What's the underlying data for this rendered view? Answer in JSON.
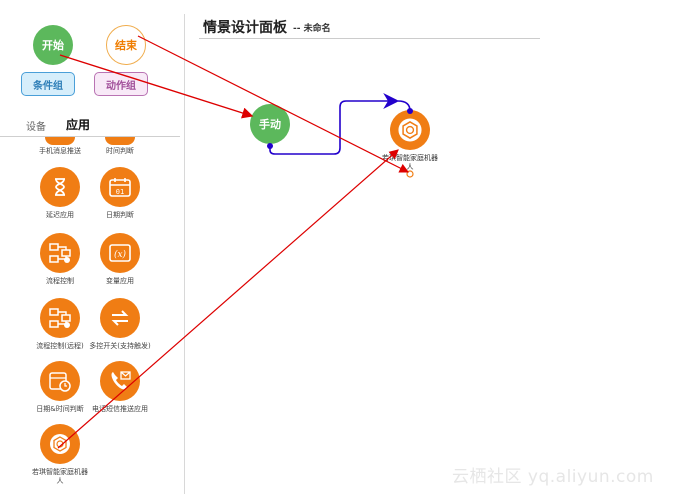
{
  "palette": {
    "start_label": "开始",
    "end_label": "结束",
    "condition_group_label": "条件组",
    "action_group_label": "动作组",
    "tabs": {
      "device": "设备",
      "app": "应用"
    },
    "items": [
      {
        "label": "手机消息推送",
        "icon": "message-push-icon"
      },
      {
        "label": "时间判断",
        "icon": "time-judge-icon"
      },
      {
        "label": "延迟应用",
        "icon": "hourglass-icon"
      },
      {
        "label": "日期判断",
        "icon": "calendar-icon"
      },
      {
        "label": "流程控制",
        "icon": "flow-control-icon"
      },
      {
        "label": "变量应用",
        "icon": "variable-icon"
      },
      {
        "label": "流程控制(远程)",
        "icon": "remote-flow-icon"
      },
      {
        "label": "多控开关(支持触发)",
        "icon": "multi-switch-icon"
      },
      {
        "label": "日期&时间判断",
        "icon": "datetime-icon"
      },
      {
        "label": "电话短信推送应用",
        "icon": "phone-sms-icon"
      },
      {
        "label": "若琪智能家庭机器人",
        "icon": "robot-icon"
      }
    ]
  },
  "panel": {
    "title": "情景设计面板",
    "subtitle": "-- 未命名"
  },
  "canvas": {
    "manual_label": "手动",
    "robot_label": "若琪智能家庭机器人"
  },
  "watermark": "云栖社区 yq.aliyun.com",
  "colors": {
    "start_green": "#5cb85c",
    "end_orange": "#f0ad4e",
    "icon_orange": "#f07d14",
    "connector_blue": "#2200cc",
    "annotation_red": "#dd0000"
  }
}
